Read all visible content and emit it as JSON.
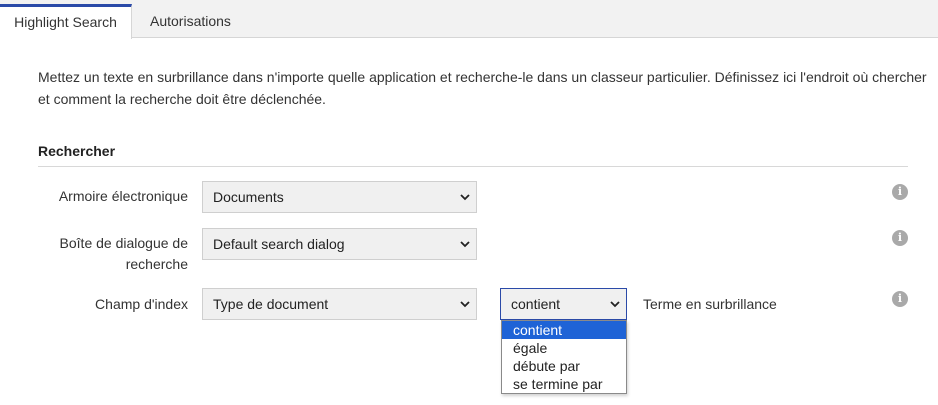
{
  "tabs": [
    {
      "label": "Highlight Search",
      "active": true
    },
    {
      "label": "Autorisations",
      "active": false
    }
  ],
  "description": "Mettez un texte en surbrillance dans n'importe quelle application et recherche-le dans un classeur particulier. Définissez ici l'endroit où chercher et comment la recherche doit être déclenchée.",
  "section": {
    "title": "Rechercher"
  },
  "fields": {
    "cabinet": {
      "label": "Armoire électronique",
      "value": "Documents"
    },
    "dialog": {
      "label_line1": "Boîte de dialogue de",
      "label_line2": "recherche",
      "value": "Default search dialog"
    },
    "index": {
      "label": "Champ d'index",
      "value": "Type de document"
    }
  },
  "operator": {
    "value": "contient",
    "options": [
      "contient",
      "égale",
      "débute par",
      "se termine par"
    ],
    "selected_index": 0
  },
  "highlight_term_label": "Terme en surbrillance",
  "icons": {
    "info": "info-icon",
    "chevron": "chevron-down-icon"
  },
  "colors": {
    "accent": "#2b4aa8",
    "selection": "#1e63d6",
    "info": "#a9a9a9"
  }
}
